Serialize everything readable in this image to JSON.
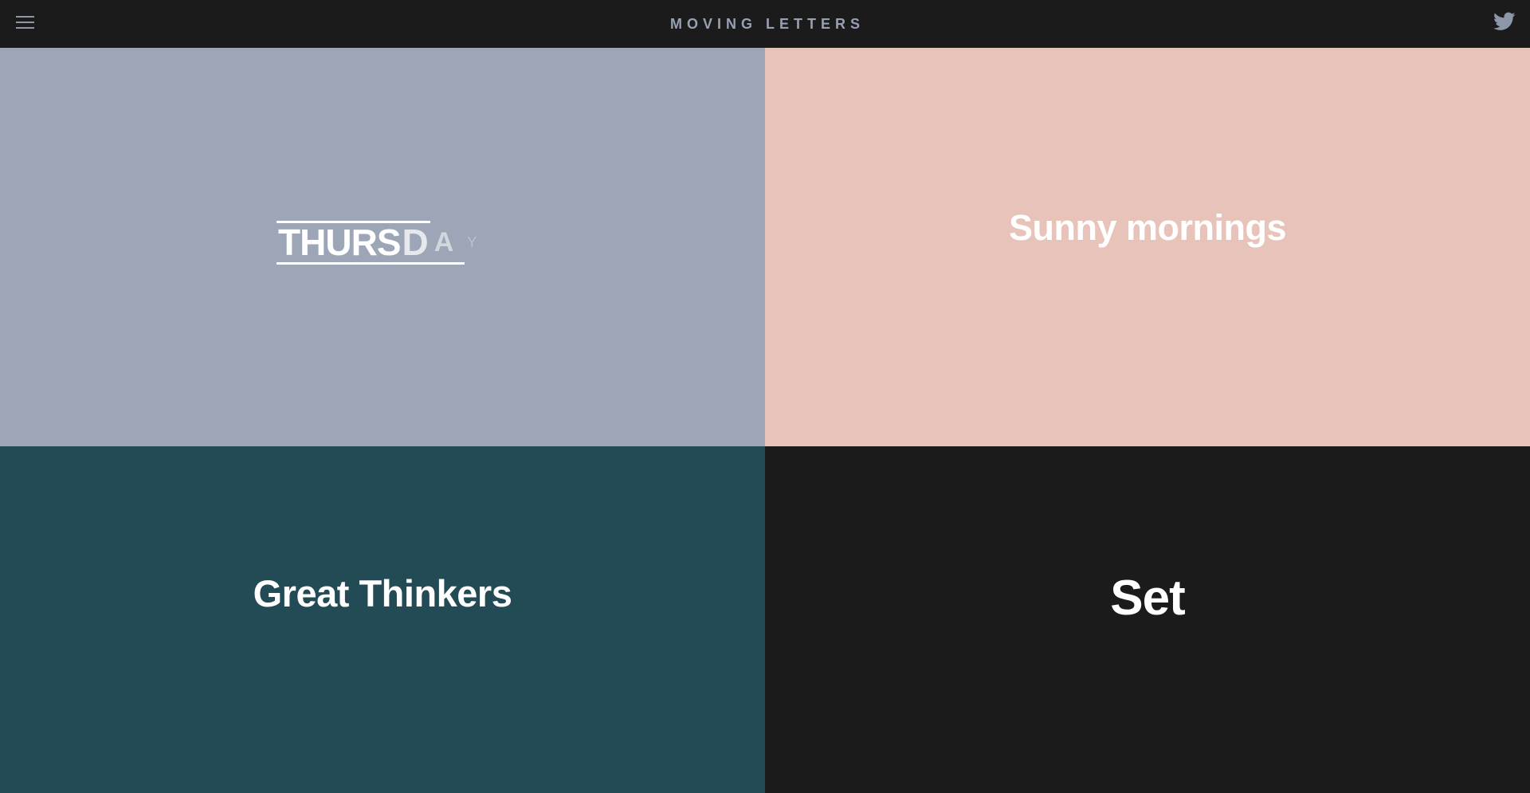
{
  "header": {
    "title": "MOVING LETTERS",
    "menu_icon": "hamburger-menu-icon",
    "social_icon": "twitter-icon"
  },
  "tiles": [
    {
      "letters": [
        "T",
        "H",
        "U",
        "R",
        "S",
        "D",
        "A",
        "Y"
      ],
      "background": "#9ca6b6"
    },
    {
      "text": "Sunny mornings",
      "background": "#e8c3b9"
    },
    {
      "text": "Great Thinkers",
      "background": "#224b55"
    },
    {
      "text": "Set",
      "background": "#1b1b1c"
    }
  ],
  "colors": {
    "header_bg": "#1b1b1c",
    "title_text": "#97a1b3",
    "icon": "#8e97a8",
    "tile_text": "#ffffff"
  }
}
